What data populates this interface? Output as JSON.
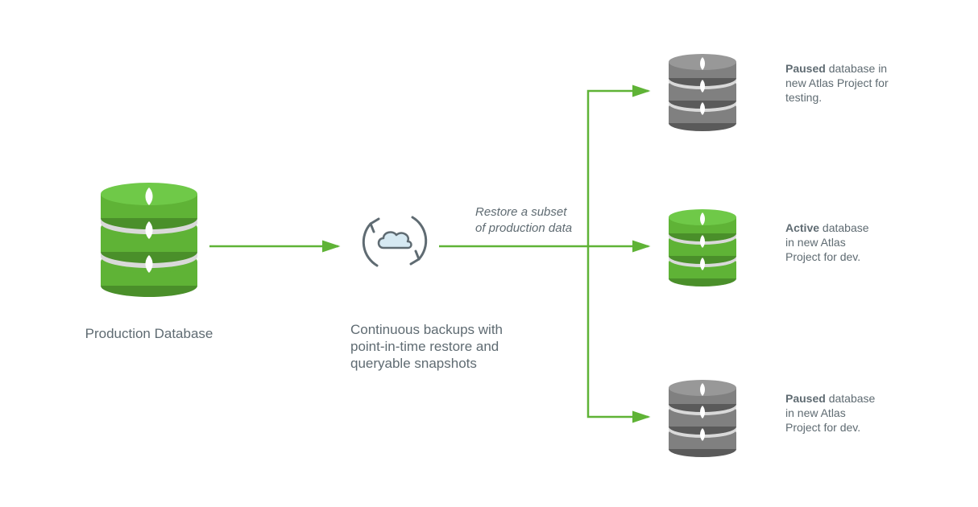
{
  "nodes": {
    "source": {
      "label": "Production Database"
    },
    "backup": {
      "line1": "Continuous backups with",
      "line2": "point-in-time restore and",
      "line3": "queryable snapshots"
    },
    "targets": [
      {
        "state": "Paused",
        "line1": "database in",
        "line2": "new Atlas Project for",
        "line3": "testing."
      },
      {
        "state": "Active",
        "line1": "database",
        "line2": "in new Atlas",
        "line3": "Project for dev."
      },
      {
        "state": "Paused",
        "line1": "database",
        "line2": "in new Atlas",
        "line3": "Project for dev."
      }
    ]
  },
  "edge_label": {
    "line1": "Restore a subset",
    "line2": "of production data"
  },
  "colors": {
    "green": "#5fb336",
    "green_dark": "#4a8f2a",
    "grey": "#808080",
    "grey_dark": "#5a5a5a",
    "text": "#5f6b72"
  }
}
